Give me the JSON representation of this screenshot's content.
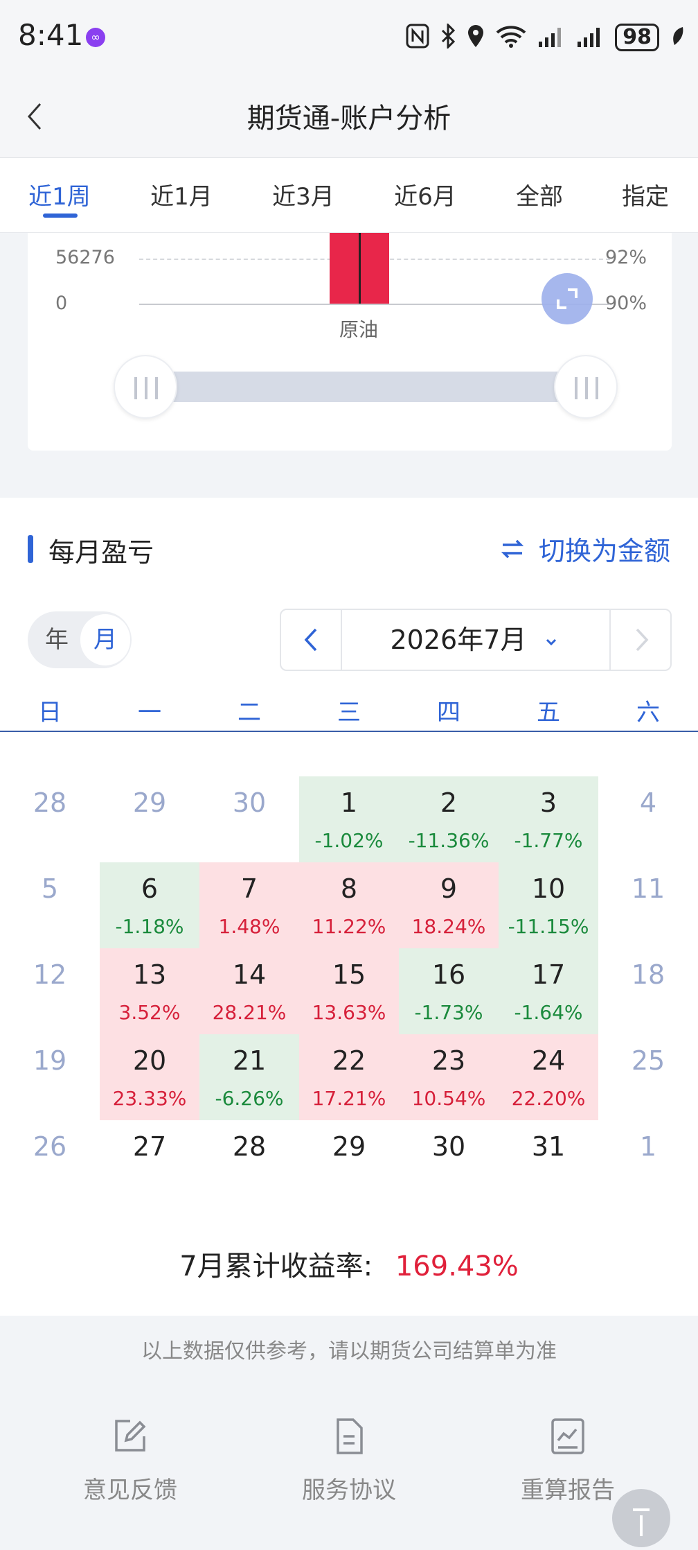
{
  "status": {
    "time": "8:41",
    "battery": "98"
  },
  "nav": {
    "title": "期货通-账户分析"
  },
  "tabs": [
    "近1周",
    "近1月",
    "近3月",
    "近6月",
    "全部",
    "指定"
  ],
  "position_chart": {
    "y_left": [
      "56276",
      "0"
    ],
    "y_right": [
      "92%",
      "90%"
    ],
    "category": "原油"
  },
  "chart_data": {
    "type": "bar",
    "categories": [
      "原油"
    ],
    "values": [
      56276
    ],
    "secondary_axis_ticks": [
      "92%",
      "90%"
    ]
  },
  "monthly": {
    "title": "每月盈亏",
    "switch_label": "切换为金额",
    "toggle": {
      "year": "年",
      "month": "月"
    },
    "month_label": "2026年7月",
    "weekdays": [
      "日",
      "一",
      "二",
      "三",
      "四",
      "五",
      "六"
    ],
    "days": [
      {
        "d": "28",
        "kind": "other"
      },
      {
        "d": "29",
        "kind": "other"
      },
      {
        "d": "30",
        "kind": "other"
      },
      {
        "d": "1",
        "p": "-1.02%",
        "kind": "loss"
      },
      {
        "d": "2",
        "p": "-11.36%",
        "kind": "loss"
      },
      {
        "d": "3",
        "p": "-1.77%",
        "kind": "loss"
      },
      {
        "d": "4",
        "kind": "weekend"
      },
      {
        "d": "5",
        "kind": "weekend"
      },
      {
        "d": "6",
        "p": "-1.18%",
        "kind": "loss"
      },
      {
        "d": "7",
        "p": "1.48%",
        "kind": "gain"
      },
      {
        "d": "8",
        "p": "11.22%",
        "kind": "gain"
      },
      {
        "d": "9",
        "p": "18.24%",
        "kind": "gain"
      },
      {
        "d": "10",
        "p": "-11.15%",
        "kind": "loss"
      },
      {
        "d": "11",
        "kind": "weekend"
      },
      {
        "d": "12",
        "kind": "weekend"
      },
      {
        "d": "13",
        "p": "3.52%",
        "kind": "gain"
      },
      {
        "d": "14",
        "p": "28.21%",
        "kind": "gain"
      },
      {
        "d": "15",
        "p": "13.63%",
        "kind": "gain"
      },
      {
        "d": "16",
        "p": "-1.73%",
        "kind": "loss"
      },
      {
        "d": "17",
        "p": "-1.64%",
        "kind": "loss"
      },
      {
        "d": "18",
        "kind": "weekend"
      },
      {
        "d": "19",
        "kind": "weekend"
      },
      {
        "d": "20",
        "p": "23.33%",
        "kind": "gain"
      },
      {
        "d": "21",
        "p": "-6.26%",
        "kind": "loss"
      },
      {
        "d": "22",
        "p": "17.21%",
        "kind": "gain"
      },
      {
        "d": "23",
        "p": "10.54%",
        "kind": "gain"
      },
      {
        "d": "24",
        "p": "22.20%",
        "kind": "gain"
      },
      {
        "d": "25",
        "kind": "weekend"
      },
      {
        "d": "26",
        "kind": "weekend"
      },
      {
        "d": "27",
        "kind": "plain"
      },
      {
        "d": "28",
        "kind": "plain"
      },
      {
        "d": "29",
        "kind": "plain"
      },
      {
        "d": "30",
        "kind": "plain"
      },
      {
        "d": "31",
        "kind": "plain"
      },
      {
        "d": "1",
        "kind": "other"
      }
    ],
    "total_label": "7月累计收益率:",
    "total_value": "169.43%"
  },
  "footer": {
    "disclaimer": "以上数据仅供参考，请以期货公司结算单为准",
    "buttons": [
      "意见反馈",
      "服务协议",
      "重算报告"
    ]
  },
  "colors": {
    "accent": "#2f64d6",
    "gain": "#d6203a",
    "loss": "#1a8a3c",
    "gain_bg": "#fde0e3",
    "loss_bg": "#e3f1e6",
    "bar": "#e8264a"
  }
}
